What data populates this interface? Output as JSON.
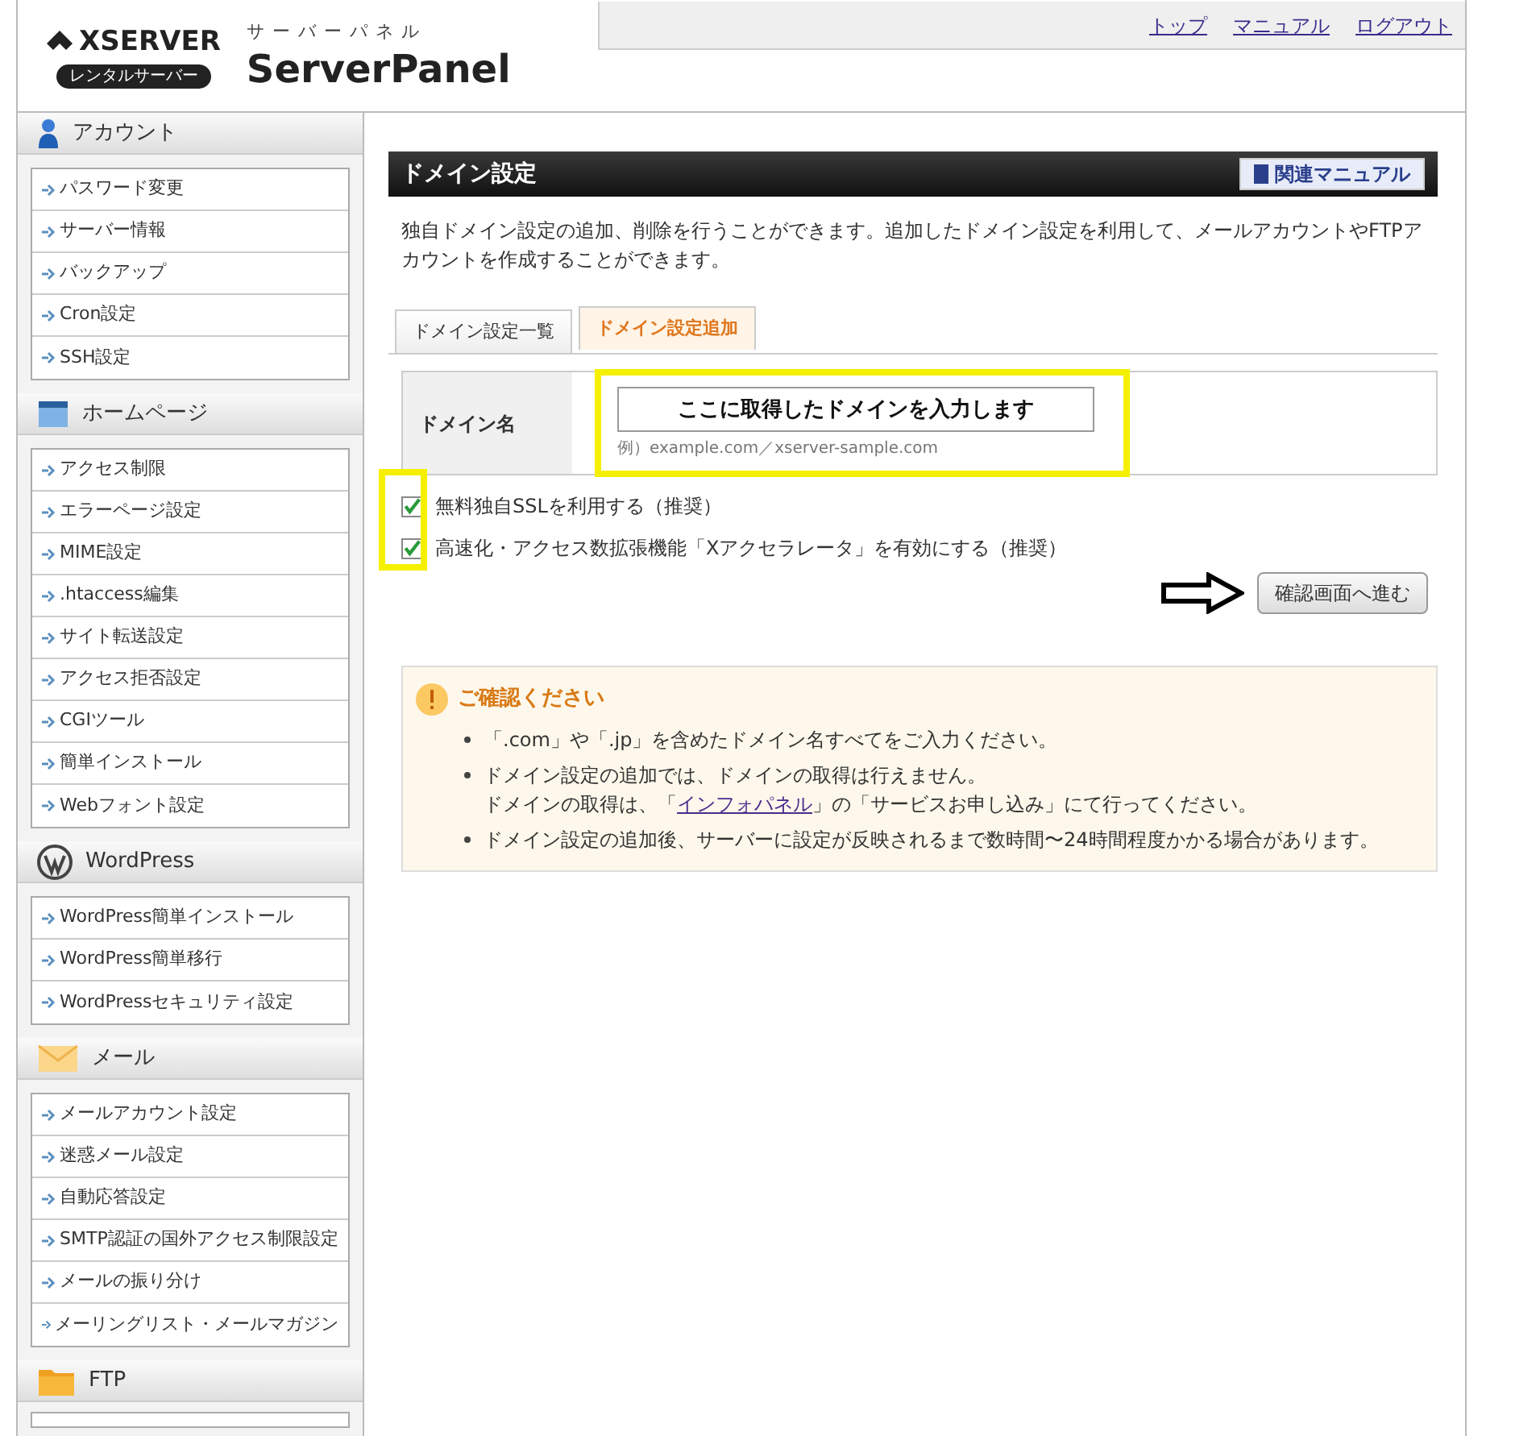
{
  "header": {
    "logo_name": "XSERVER",
    "logo_badge": "レンタルサーバー",
    "panel_kana": "サーバーパネル",
    "panel_name": "ServerPanel",
    "links": [
      "トップ",
      "マニュアル",
      "ログアウト"
    ]
  },
  "sidebar": [
    {
      "kind": "account",
      "title": "アカウント",
      "items": [
        "パスワード変更",
        "サーバー情報",
        "バックアップ",
        "Cron設定",
        "SSH設定"
      ]
    },
    {
      "kind": "homepage",
      "title": "ホームページ",
      "items": [
        "アクセス制限",
        "エラーページ設定",
        "MIME設定",
        ".htaccess編集",
        "サイト転送設定",
        "アクセス拒否設定",
        "CGIツール",
        "簡単インストール",
        "Webフォント設定"
      ]
    },
    {
      "kind": "wordpress",
      "title": "WordPress",
      "items": [
        "WordPress簡単インストール",
        "WordPress簡単移行",
        "WordPressセキュリティ設定"
      ]
    },
    {
      "kind": "mail",
      "title": "メール",
      "items": [
        "メールアカウント設定",
        "迷惑メール設定",
        "自動応答設定",
        "SMTP認証の国外アクセス制限設定",
        "メールの振り分け",
        "メーリングリスト・メールマガジン"
      ]
    },
    {
      "kind": "ftp",
      "title": "FTP"
    }
  ],
  "main": {
    "title": "ドメイン設定",
    "manual_button": "関連マニュアル",
    "description": "独自ドメイン設定の追加、削除を行うことができます。追加したドメイン設定を利用して、メールアカウントやFTPアカウントを作成することができます。",
    "tabs": [
      {
        "label": "ドメイン設定一覧",
        "selected": false
      },
      {
        "label": "ドメイン設定追加",
        "selected": true
      }
    ],
    "form": {
      "label": "ドメイン名",
      "value": "ここに取得したドメインを入力します",
      "hint": "例）example.com／xserver-sample.com"
    },
    "options": [
      {
        "label": "無料独自SSLを利用する（推奨）",
        "checked": true
      },
      {
        "label": "高速化・アクセス数拡張機能「Xアクセラレータ」を有効にする（推奨）",
        "checked": true
      }
    ],
    "submit": "確認画面へ進む",
    "notice": {
      "title": "ご確認ください",
      "items": [
        {
          "text": "「.com」や「.jp」を含めたドメイン名すべてをご入力ください。"
        },
        {
          "text": "ドメイン設定の追加では、ドメインの取得は行えません。",
          "before": "ドメインの取得は、「",
          "link": "インフォパネル",
          "after": "」の「サービスお申し込み」にて行ってください。"
        },
        {
          "text": "ドメイン設定の追加後、サーバーに設定が反映されるまで数時間〜24時間程度かかる場合があります。"
        }
      ]
    }
  }
}
